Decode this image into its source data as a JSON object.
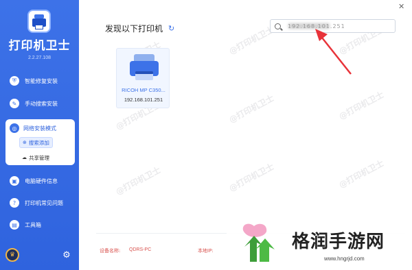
{
  "sidebar": {
    "app_name": "打印机卫士",
    "version": "2.2.27.108",
    "items": [
      {
        "label": "智能修复安装",
        "icon": "repair-icon"
      },
      {
        "label": "手动搜索安装",
        "icon": "wrench-icon"
      },
      {
        "label": "网络安装模式",
        "icon": "network-icon"
      },
      {
        "label": "电脑硬件信息",
        "icon": "hardware-icon"
      },
      {
        "label": "打印机常见问题",
        "icon": "faq-icon"
      },
      {
        "label": "工具箱",
        "icon": "toolbox-icon"
      }
    ],
    "sub_items": [
      {
        "label": "搜索添加",
        "icon": "add-search-icon"
      },
      {
        "label": "共享管理",
        "icon": "cloud-icon"
      }
    ]
  },
  "main": {
    "heading": "发现以下打印机",
    "search_value": "192.168.101.251",
    "printers": [
      {
        "name": "RICOH MP C350...",
        "ip": "192.168.101.251"
      }
    ],
    "watermark": "@打印机卫士",
    "device_label": "设备名称:",
    "device_name": "QDRS-PC",
    "ip_label": "本地IP:"
  },
  "site_logo": {
    "name": "格润手游网",
    "url": "www.hngrjd.com"
  },
  "colors": {
    "sidebar": "#3d72e8",
    "accent": "#2f63de",
    "arrow": "#e8333a",
    "footer_text": "#d9534f",
    "leaf_green": "#3e9e3a",
    "leaf_pink": "#f4a7c8"
  }
}
